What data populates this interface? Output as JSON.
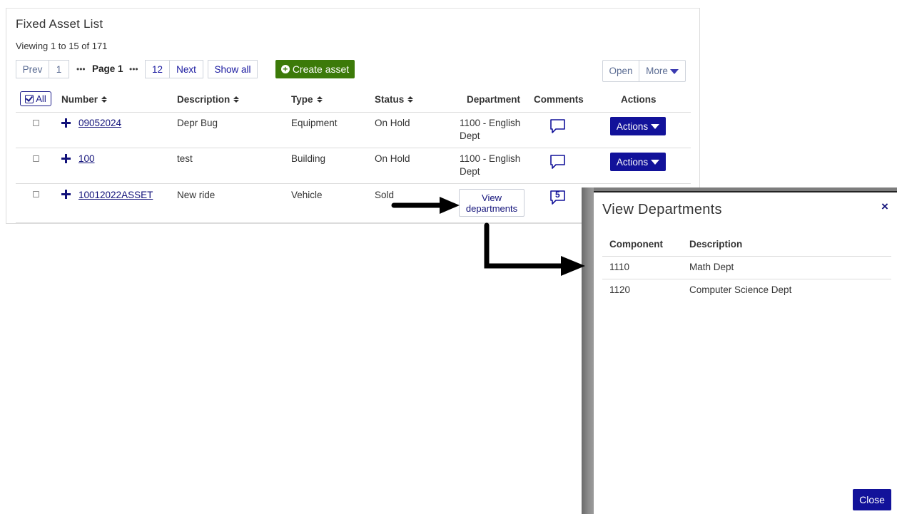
{
  "panel": {
    "title": "Fixed Asset List",
    "viewing": "Viewing 1 to 15 of 171"
  },
  "pagination": {
    "prev": "Prev",
    "first": "1",
    "current": "Page 1",
    "last": "12",
    "next": "Next",
    "show_all": "Show all"
  },
  "toolbar": {
    "create": "Create asset",
    "open": "Open",
    "more": "More"
  },
  "table": {
    "select_all": "All",
    "headers": {
      "number": "Number",
      "description": "Description",
      "type": "Type",
      "status": "Status",
      "department": "Department",
      "comments": "Comments",
      "actions": "Actions"
    },
    "rows": [
      {
        "number": "09052024",
        "description": "Depr Bug",
        "type": "Equipment",
        "status": "On Hold",
        "department_1": "1100 - English",
        "department_2": "Dept",
        "comments": "",
        "action": "Actions"
      },
      {
        "number": "100",
        "description": "test",
        "type": "Building",
        "status": "On Hold",
        "department_1": "1100 - English",
        "department_2": "Dept",
        "comments": "",
        "action": "Actions"
      },
      {
        "number": "10012022ASSET",
        "description": "New ride",
        "type": "Vehicle",
        "status": "Sold",
        "department_1": "View",
        "department_2": "departments",
        "comments": "5",
        "action": ""
      }
    ]
  },
  "modal": {
    "title": "View Departments",
    "close_x": "×",
    "headers": {
      "component": "Component",
      "description": "Description"
    },
    "rows": [
      {
        "component": "1110",
        "description": "Math Dept"
      },
      {
        "component": "1120",
        "description": "Computer Science Dept"
      }
    ],
    "close": "Close"
  },
  "colors": {
    "primary": "#12129a",
    "create": "#3c7a09",
    "link": "#12127a"
  }
}
